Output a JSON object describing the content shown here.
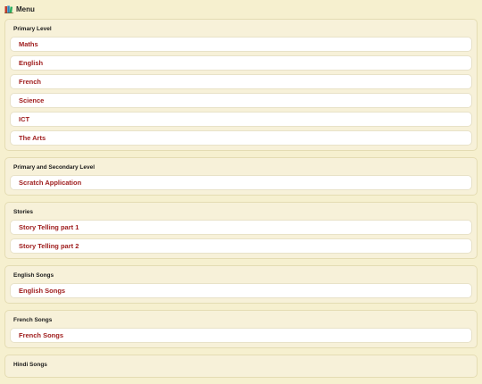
{
  "header": {
    "icon": "books-icon",
    "title": "Menu"
  },
  "sections": [
    {
      "title": "Primary Level",
      "items": [
        "Maths",
        "English",
        "French",
        "Science",
        "ICT",
        "The Arts"
      ]
    },
    {
      "title": "Primary and Secondary Level",
      "items": [
        "Scratch Application"
      ]
    },
    {
      "title": "Stories",
      "items": [
        "Story Telling part 1",
        "Story Telling part 2"
      ]
    },
    {
      "title": "English Songs",
      "items": [
        "English Songs"
      ]
    },
    {
      "title": "French Songs",
      "items": [
        "French Songs"
      ]
    },
    {
      "title": "Hindi Songs",
      "items": []
    }
  ],
  "colors": {
    "background": "#f6f0cf",
    "link": "#9e1b1b",
    "card": "#ffffff"
  }
}
